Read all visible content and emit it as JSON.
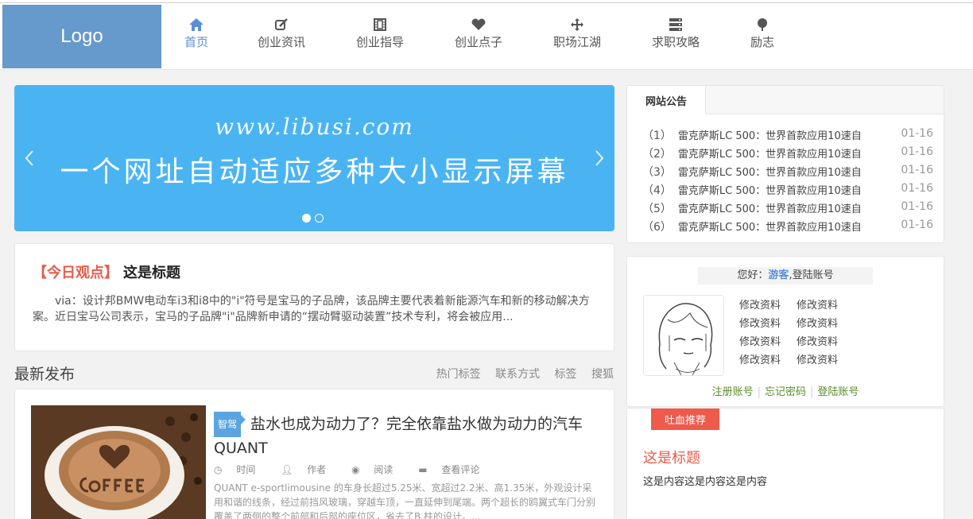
{
  "header": {
    "logo": "Logo",
    "nav": [
      {
        "label": "首页",
        "icon": "home-icon",
        "active": true
      },
      {
        "label": "创业资讯",
        "icon": "edit-icon"
      },
      {
        "label": "创业指导",
        "icon": "film-icon"
      },
      {
        "label": "创业点子",
        "icon": "heart-icon"
      },
      {
        "label": "职场江湖",
        "icon": "move-icon"
      },
      {
        "label": "求职攻略",
        "icon": "server-icon"
      },
      {
        "label": "励志",
        "icon": "tree-icon"
      }
    ]
  },
  "banner": {
    "url_text": "www.libusi.com",
    "slogan": "一个网址自动适应多种大小显示屏幕",
    "active_slide": 1,
    "slide_count": 2
  },
  "viewpoint": {
    "tag": "【今日观点】",
    "title": "这是标题",
    "text": "via：设计邦BMW电动车i3和i8中的\"i\"符号是宝马的子品牌，该品牌主要代表着新能源汽车和新的移动解决方案。近日宝马公司表示，宝马的子品牌\"i\"品牌新申请的“摆动臂驱动装置”技术专利，将会被应用..."
  },
  "latest": {
    "title": "最新发布",
    "links": [
      "热门标签",
      "联系方式",
      "标签",
      "搜狐"
    ]
  },
  "article": {
    "tag": "智驾",
    "title": "盐水也成为动力了？完全依靠盐水做为动力的汽车QUANT",
    "meta": [
      "时间",
      "作者",
      "阅读",
      "查看评论"
    ],
    "desc": "QUANT e-sportlimousine 的车身长超过5.25米、宽超过2.2米、高1.35米，外观设计采用和谐的线条，经过前挡风玻璃，穿越车顶，一直延伸到尾端。两个超长的鸥翼式车门分别覆盖了两侧的整个前部和后部的座位区，省去了B 柱的设计。..."
  },
  "notice": {
    "tab": "网站公告",
    "items": [
      {
        "num": "（1）",
        "text": "雷克萨斯LC 500：世界首款应用10速自",
        "date": "01-16"
      },
      {
        "num": "（2）",
        "text": "雷克萨斯LC 500：世界首款应用10速自",
        "date": "01-16"
      },
      {
        "num": "（3）",
        "text": "雷克萨斯LC 500：世界首款应用10速自",
        "date": "01-16"
      },
      {
        "num": "（4）",
        "text": "雷克萨斯LC 500：世界首款应用10速自",
        "date": "01-16"
      },
      {
        "num": "（5）",
        "text": "雷克萨斯LC 500：世界首款应用10速自",
        "date": "01-16"
      },
      {
        "num": "（6）",
        "text": "雷克萨斯LC 500：世界首款应用10速自",
        "date": "01-16"
      }
    ]
  },
  "user": {
    "greet_prefix": "您好：",
    "guest": "游客",
    "greet_suffix": ",登陆账号",
    "edit_links": [
      "修改资料",
      "修改资料",
      "修改资料",
      "修改资料",
      "修改资料",
      "修改资料",
      "修改资料",
      "修改资料"
    ],
    "register": "注册账号",
    "forgot": "忘记密码",
    "login": "登陆账号"
  },
  "recommend": {
    "tag": "吐血推荐",
    "title": "这是标题",
    "content": "这是内容这是内容这是内容"
  },
  "colors": {
    "accent": "#5b8fd6",
    "logo_bg": "#6699cc",
    "banner_bg": "#4ab4f3",
    "highlight": "#ef5a4b"
  }
}
